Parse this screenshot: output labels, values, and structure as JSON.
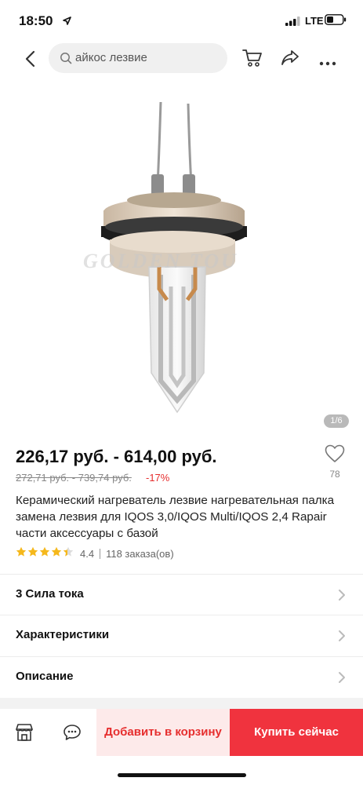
{
  "status_bar": {
    "time": "18:50",
    "network": "LTE",
    "icons": [
      "location-arrow-icon",
      "signal-icon",
      "battery-icon"
    ]
  },
  "nav": {
    "search_text": "айкос лезвие",
    "icons": [
      "back-icon",
      "search-icon",
      "cart-icon",
      "share-icon",
      "more-icon"
    ]
  },
  "gallery": {
    "watermark": "GOLDEN TOU",
    "counter": "1/6"
  },
  "product": {
    "price": "226,17 руб. - 614,00 руб.",
    "old_price": "272,71 руб. - 739,74 руб.",
    "discount": "-17%",
    "wishlist_count": "78",
    "title": "Керамический нагреватель лезвие нагревательная палка замена лезвия для IQOS 3,0/IQOS Multi/IQOS 2,4 Rapair части аксессуары с базой",
    "rating": "4.4",
    "rating_stars": 4.4,
    "orders": "118 заказа(ов)"
  },
  "rows": {
    "current": "3 Сила тока",
    "specs": "Характеристики",
    "description": "Описание"
  },
  "bottom_bar": {
    "add_to_cart": "Добавить в корзину",
    "buy_now": "Купить сейчас"
  },
  "colors": {
    "accent": "#f0333e",
    "discount": "#e62e2e",
    "add_cart_bg": "#fdeaea",
    "star": "#f5b81c"
  }
}
